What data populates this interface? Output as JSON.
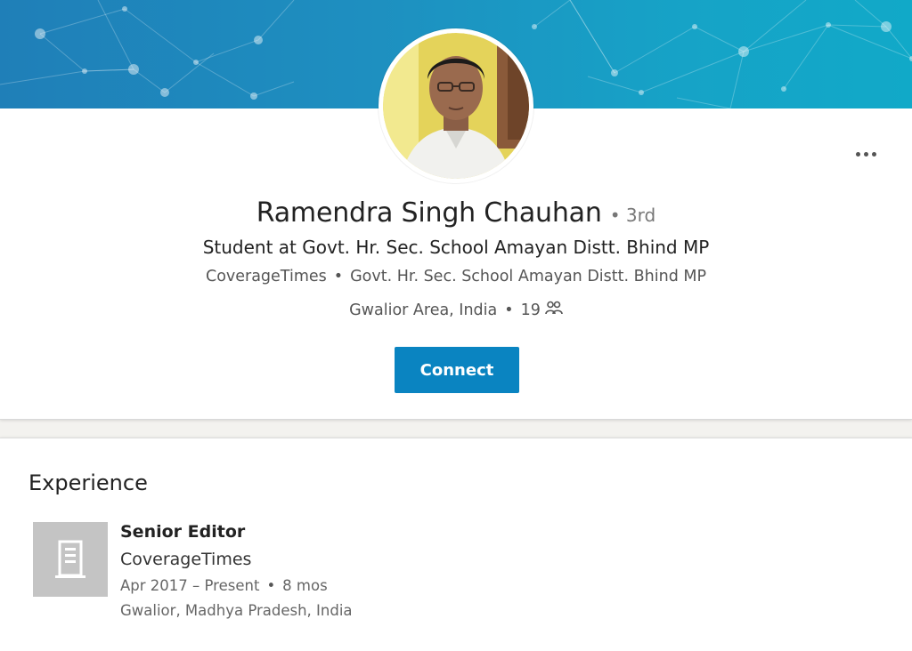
{
  "profile": {
    "name": "Ramendra Singh Chauhan",
    "degree": "• 3rd",
    "headline": "Student at Govt. Hr. Sec. School Amayan Distt. Bhind MP",
    "company": "CoverageTimes",
    "school": "Govt. Hr. Sec. School Amayan Distt. Bhind MP",
    "location": "Gwalior Area, India",
    "connections": "19",
    "connect_label": "Connect"
  },
  "experience": {
    "section_title": "Experience",
    "items": [
      {
        "title": "Senior Editor",
        "company": "CoverageTimes",
        "dates": "Apr 2017 – Present",
        "duration": "8 mos",
        "location": "Gwalior, Madhya Pradesh, India"
      }
    ]
  },
  "colors": {
    "banner": "#1e8fc0",
    "accent": "#0a84c1",
    "logo_placeholder": "#c4c4c4"
  },
  "icons": {
    "overflow": "more-horizontal-icon",
    "connections": "people-icon",
    "company": "building-icon"
  }
}
